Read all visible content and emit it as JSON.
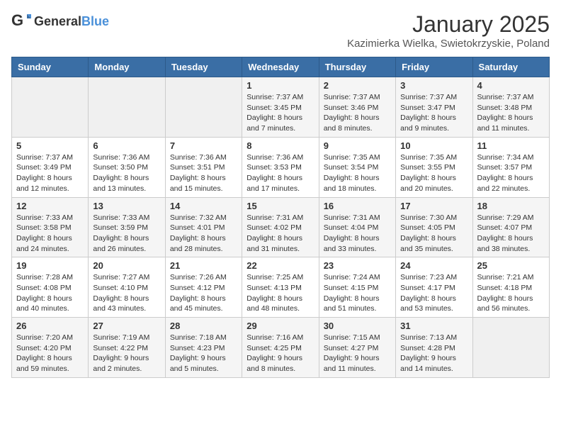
{
  "header": {
    "logo_general": "General",
    "logo_blue": "Blue",
    "month": "January 2025",
    "location": "Kazimierka Wielka, Swietokrzyskie, Poland"
  },
  "weekdays": [
    "Sunday",
    "Monday",
    "Tuesday",
    "Wednesday",
    "Thursday",
    "Friday",
    "Saturday"
  ],
  "weeks": [
    [
      {
        "day": "",
        "info": ""
      },
      {
        "day": "",
        "info": ""
      },
      {
        "day": "",
        "info": ""
      },
      {
        "day": "1",
        "info": "Sunrise: 7:37 AM\nSunset: 3:45 PM\nDaylight: 8 hours\nand 7 minutes."
      },
      {
        "day": "2",
        "info": "Sunrise: 7:37 AM\nSunset: 3:46 PM\nDaylight: 8 hours\nand 8 minutes."
      },
      {
        "day": "3",
        "info": "Sunrise: 7:37 AM\nSunset: 3:47 PM\nDaylight: 8 hours\nand 9 minutes."
      },
      {
        "day": "4",
        "info": "Sunrise: 7:37 AM\nSunset: 3:48 PM\nDaylight: 8 hours\nand 11 minutes."
      }
    ],
    [
      {
        "day": "5",
        "info": "Sunrise: 7:37 AM\nSunset: 3:49 PM\nDaylight: 8 hours\nand 12 minutes."
      },
      {
        "day": "6",
        "info": "Sunrise: 7:36 AM\nSunset: 3:50 PM\nDaylight: 8 hours\nand 13 minutes."
      },
      {
        "day": "7",
        "info": "Sunrise: 7:36 AM\nSunset: 3:51 PM\nDaylight: 8 hours\nand 15 minutes."
      },
      {
        "day": "8",
        "info": "Sunrise: 7:36 AM\nSunset: 3:53 PM\nDaylight: 8 hours\nand 17 minutes."
      },
      {
        "day": "9",
        "info": "Sunrise: 7:35 AM\nSunset: 3:54 PM\nDaylight: 8 hours\nand 18 minutes."
      },
      {
        "day": "10",
        "info": "Sunrise: 7:35 AM\nSunset: 3:55 PM\nDaylight: 8 hours\nand 20 minutes."
      },
      {
        "day": "11",
        "info": "Sunrise: 7:34 AM\nSunset: 3:57 PM\nDaylight: 8 hours\nand 22 minutes."
      }
    ],
    [
      {
        "day": "12",
        "info": "Sunrise: 7:33 AM\nSunset: 3:58 PM\nDaylight: 8 hours\nand 24 minutes."
      },
      {
        "day": "13",
        "info": "Sunrise: 7:33 AM\nSunset: 3:59 PM\nDaylight: 8 hours\nand 26 minutes."
      },
      {
        "day": "14",
        "info": "Sunrise: 7:32 AM\nSunset: 4:01 PM\nDaylight: 8 hours\nand 28 minutes."
      },
      {
        "day": "15",
        "info": "Sunrise: 7:31 AM\nSunset: 4:02 PM\nDaylight: 8 hours\nand 31 minutes."
      },
      {
        "day": "16",
        "info": "Sunrise: 7:31 AM\nSunset: 4:04 PM\nDaylight: 8 hours\nand 33 minutes."
      },
      {
        "day": "17",
        "info": "Sunrise: 7:30 AM\nSunset: 4:05 PM\nDaylight: 8 hours\nand 35 minutes."
      },
      {
        "day": "18",
        "info": "Sunrise: 7:29 AM\nSunset: 4:07 PM\nDaylight: 8 hours\nand 38 minutes."
      }
    ],
    [
      {
        "day": "19",
        "info": "Sunrise: 7:28 AM\nSunset: 4:08 PM\nDaylight: 8 hours\nand 40 minutes."
      },
      {
        "day": "20",
        "info": "Sunrise: 7:27 AM\nSunset: 4:10 PM\nDaylight: 8 hours\nand 43 minutes."
      },
      {
        "day": "21",
        "info": "Sunrise: 7:26 AM\nSunset: 4:12 PM\nDaylight: 8 hours\nand 45 minutes."
      },
      {
        "day": "22",
        "info": "Sunrise: 7:25 AM\nSunset: 4:13 PM\nDaylight: 8 hours\nand 48 minutes."
      },
      {
        "day": "23",
        "info": "Sunrise: 7:24 AM\nSunset: 4:15 PM\nDaylight: 8 hours\nand 51 minutes."
      },
      {
        "day": "24",
        "info": "Sunrise: 7:23 AM\nSunset: 4:17 PM\nDaylight: 8 hours\nand 53 minutes."
      },
      {
        "day": "25",
        "info": "Sunrise: 7:21 AM\nSunset: 4:18 PM\nDaylight: 8 hours\nand 56 minutes."
      }
    ],
    [
      {
        "day": "26",
        "info": "Sunrise: 7:20 AM\nSunset: 4:20 PM\nDaylight: 8 hours\nand 59 minutes."
      },
      {
        "day": "27",
        "info": "Sunrise: 7:19 AM\nSunset: 4:22 PM\nDaylight: 9 hours\nand 2 minutes."
      },
      {
        "day": "28",
        "info": "Sunrise: 7:18 AM\nSunset: 4:23 PM\nDaylight: 9 hours\nand 5 minutes."
      },
      {
        "day": "29",
        "info": "Sunrise: 7:16 AM\nSunset: 4:25 PM\nDaylight: 9 hours\nand 8 minutes."
      },
      {
        "day": "30",
        "info": "Sunrise: 7:15 AM\nSunset: 4:27 PM\nDaylight: 9 hours\nand 11 minutes."
      },
      {
        "day": "31",
        "info": "Sunrise: 7:13 AM\nSunset: 4:28 PM\nDaylight: 9 hours\nand 14 minutes."
      },
      {
        "day": "",
        "info": ""
      }
    ]
  ]
}
